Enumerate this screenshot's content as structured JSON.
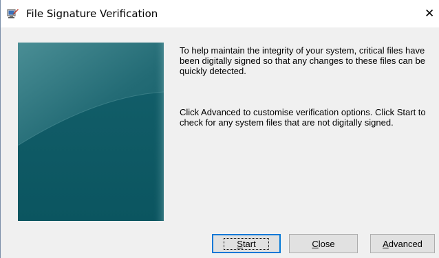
{
  "window": {
    "title": "File Signature Verification",
    "close_glyph": "✕",
    "title_icon": "sigverif-app-icon"
  },
  "banner": {
    "image": "teal-gradient-banner",
    "colors": {
      "base": "#0e5a66",
      "light": "#3f8790",
      "dark": "#0a4b56"
    }
  },
  "body": {
    "paragraph1": "To help maintain the integrity of your system, critical files have been digitally signed so that any changes to these files can be quickly detected.",
    "paragraph2": "Click Advanced to customise verification options. Click Start to check for any system files that are not digitally signed."
  },
  "buttons": {
    "start": {
      "mnemonic": "S",
      "rest": "tart"
    },
    "close": {
      "mnemonic": "C",
      "rest": "lose"
    },
    "advanced": {
      "mnemonic": "A",
      "rest": "dvanced"
    }
  }
}
